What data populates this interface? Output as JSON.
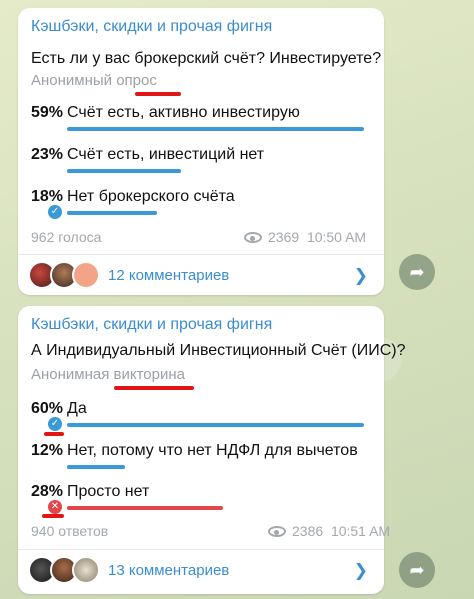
{
  "posts": [
    {
      "channel": "Кэшбэки, скидки и прочая фигня",
      "question": "Есть ли у вас брокерский счёт? Инвестируете?",
      "poll_type": "Анонимный опрос",
      "options": [
        {
          "percent": "59%",
          "text": "Счёт есть, активно инвестирую",
          "fill": 0.59
        },
        {
          "percent": "23%",
          "text": "Счёт есть, инвестиций нет",
          "fill": 0.23
        },
        {
          "percent": "18%",
          "text": "Нет брокерского счёта",
          "fill": 0.18,
          "selected": true
        }
      ],
      "votes": "962 голоса",
      "views": "2369",
      "time": "10:50 AM",
      "comments": "12 комментариев"
    },
    {
      "channel": "Кэшбэки, скидки и прочая фигня",
      "question": "А Индивидуальный Инвестиционный Счёт (ИИС)?",
      "poll_type": "Анонимная викторина",
      "options": [
        {
          "percent": "60%",
          "text": "Да",
          "fill": 0.6,
          "correct": true
        },
        {
          "percent": "12%",
          "text": "Нет, потому что нет НДФЛ для вычетов",
          "fill": 0.12
        },
        {
          "percent": "28%",
          "text": "Просто нет",
          "fill": 0.28,
          "wrong": true
        }
      ],
      "votes": "940 ответов",
      "views": "2386",
      "time": "10:51 AM",
      "comments": "13 комментариев"
    }
  ],
  "colors": {
    "accent": "#3a8dd0",
    "bar": "#3a9ad9",
    "wrong": "#e0464a",
    "annotation": "#e01515"
  },
  "icons": [
    "eye-icon",
    "chevron-right-icon",
    "share-arrow-icon",
    "check-icon",
    "cross-icon"
  ]
}
